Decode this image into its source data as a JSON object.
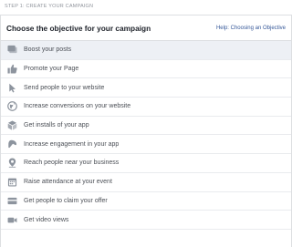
{
  "step": {
    "label": "STEP 1: CREATE YOUR CAMPAIGN"
  },
  "header": {
    "title": "Choose the objective for your campaign",
    "help_link": "Help: Choosing an Objective"
  },
  "colors": {
    "icon": "#8d949e",
    "selected_bg": "#edf0f5",
    "link": "#365899"
  },
  "objectives": [
    {
      "label": "Boost your posts",
      "icon": "posts-icon",
      "selected": true
    },
    {
      "label": "Promote your Page",
      "icon": "thumbs-up-icon",
      "selected": false
    },
    {
      "label": "Send people to your website",
      "icon": "cursor-icon",
      "selected": false
    },
    {
      "label": "Increase conversions on your website",
      "icon": "globe-icon",
      "selected": false
    },
    {
      "label": "Get installs of your app",
      "icon": "cube-icon",
      "selected": false
    },
    {
      "label": "Increase engagement in your app",
      "icon": "joystick-icon",
      "selected": false
    },
    {
      "label": "Reach people near your business",
      "icon": "map-pin-icon",
      "selected": false
    },
    {
      "label": "Raise attendance at your event",
      "icon": "calendar-icon",
      "selected": false
    },
    {
      "label": "Get people to claim your offer",
      "icon": "offer-icon",
      "selected": false
    },
    {
      "label": "Get video views",
      "icon": "video-camera-icon",
      "selected": false
    }
  ]
}
